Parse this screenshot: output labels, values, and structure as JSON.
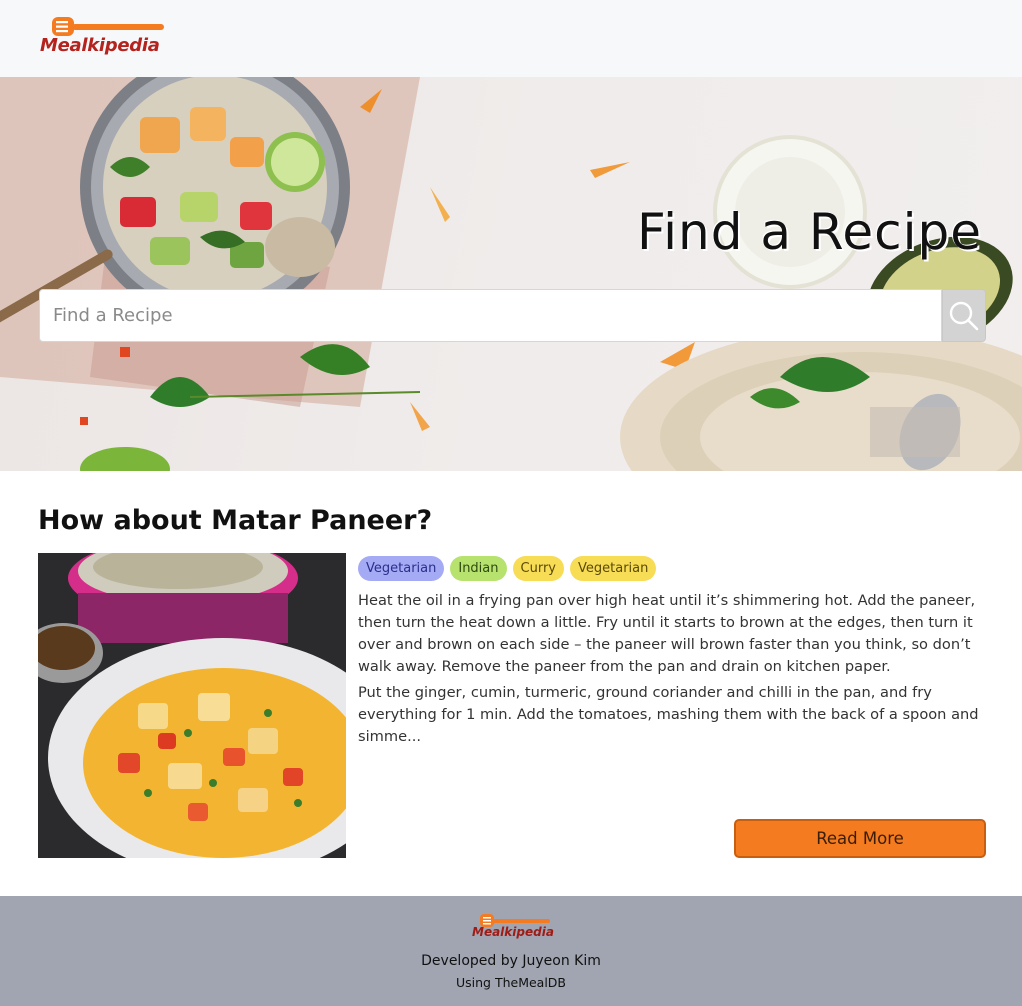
{
  "brand": {
    "name": "Mealkipedia",
    "accent": "#f47b20",
    "text_color": "#b4231d"
  },
  "hero": {
    "title": "Find a Recipe",
    "search_placeholder": "Find a Recipe",
    "search_value": "",
    "search_icon": "search-icon"
  },
  "suggestion": {
    "heading": "How about Matar Paneer?",
    "meal_name": "Matar Paneer",
    "tags": [
      {
        "label": "Vegetarian",
        "kind": "category",
        "color": "#a5aaf5"
      },
      {
        "label": "Indian",
        "kind": "area",
        "color": "#b6e26d"
      },
      {
        "label": "Curry",
        "kind": "keyword",
        "color": "#f7dc55"
      },
      {
        "label": "Vegetarian",
        "kind": "keyword",
        "color": "#f7dc55"
      }
    ],
    "instructions": [
      "Heat the oil in a frying pan over high heat until it’s shimmering hot. Add the paneer, then turn the heat down a little. Fry until it starts to brown at the edges, then turn it over and brown on each side – the paneer will brown faster than you think, so don’t walk away. Remove the paneer from the pan and drain on kitchen paper.",
      "Put the ginger, cumin, turmeric, ground coriander and chilli in the pan, and fry everything for 1 min. Add the tomatoes, mashing them with the back of a spoon and simme..."
    ],
    "read_more_label": "Read More"
  },
  "footer": {
    "brand": "Mealkipedia",
    "developed_by": "Developed by Juyeon Kim",
    "using": "Using TheMealDB"
  }
}
